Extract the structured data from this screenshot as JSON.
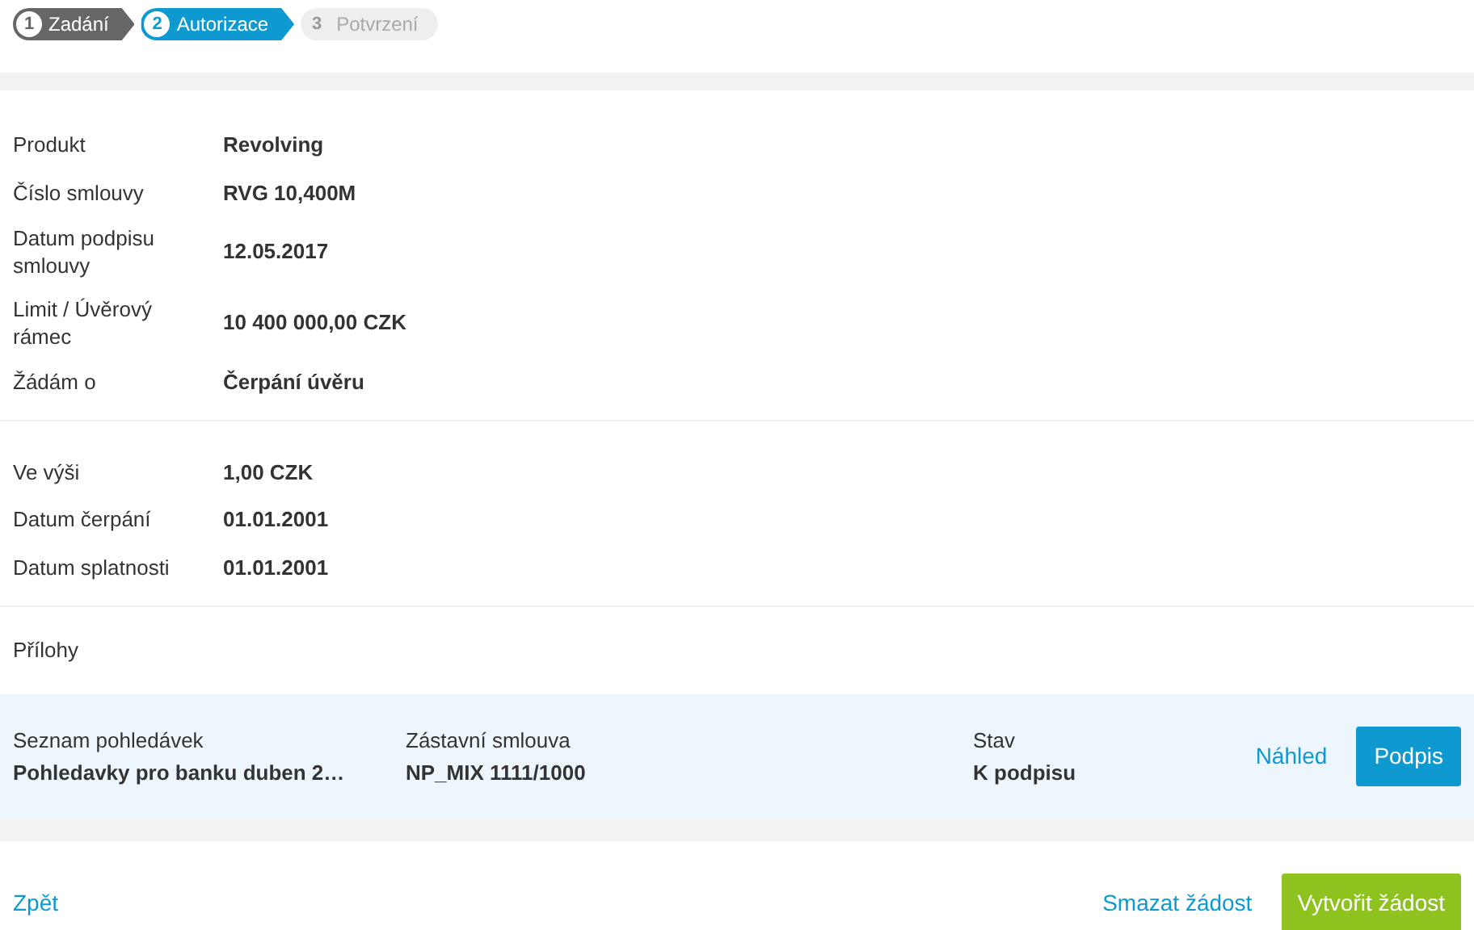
{
  "steps": [
    {
      "number": "1",
      "label": "Zadání",
      "kind": "done"
    },
    {
      "number": "2",
      "label": "Autorizace",
      "kind": "current"
    },
    {
      "number": "3",
      "label": "Potvrzení",
      "kind": "pending"
    }
  ],
  "details": [
    {
      "label": "Produkt",
      "value": "Revolving"
    },
    {
      "label": "Číslo smlouvy",
      "value": "RVG 10,400M"
    },
    {
      "label": "Datum podpisu smlouvy",
      "value": "12.05.2017"
    },
    {
      "label": "Limit / Úvěrový rámec",
      "value": "10 400 000,00 CZK"
    },
    {
      "label": "Žádám o",
      "value": "Čerpání úvěru"
    }
  ],
  "drawdown": [
    {
      "label": "Ve výši",
      "value": "1,00 CZK"
    },
    {
      "label": "Datum čerpání",
      "value": "01.01.2001"
    },
    {
      "label": "Datum splatnosti",
      "value": "01.01.2001"
    }
  ],
  "attachments": {
    "title": "Přílohy",
    "item": {
      "list_label": "Seznam pohledávek",
      "list_value": "Pohledavky pro banku duben 2…",
      "contract_label": "Zástavní smlouva",
      "contract_value": "NP_MIX 1111/1000",
      "status_label": "Stav",
      "status_value": "K podpisu",
      "preview": "Náhled",
      "sign": "Podpis"
    }
  },
  "footer": {
    "back": "Zpět",
    "delete": "Smazat žádost",
    "create": "Vytvořit žádost"
  }
}
